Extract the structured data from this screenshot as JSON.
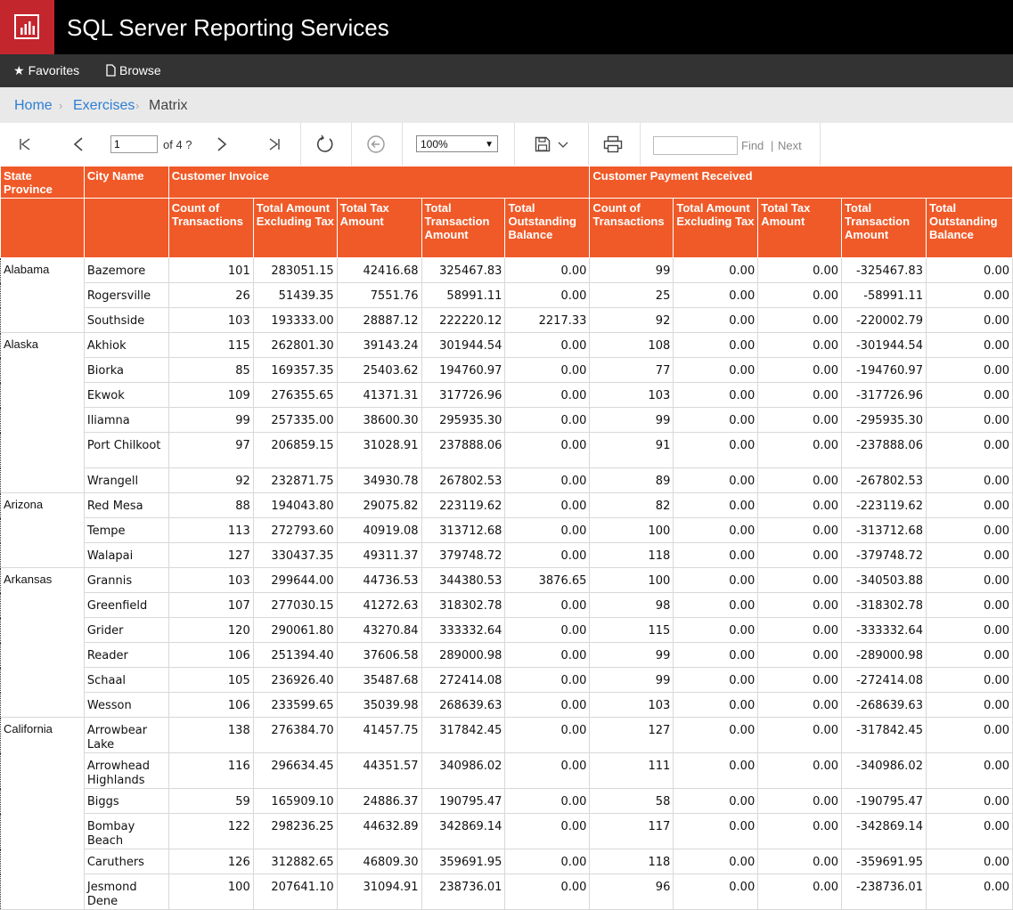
{
  "app": {
    "title": "SQL Server Reporting Services",
    "brand_color": "#c4262e"
  },
  "nav": {
    "favorites": "Favorites",
    "browse": "Browse"
  },
  "breadcrumb": {
    "home": "Home",
    "exercises": "Exercises",
    "current": "Matrix"
  },
  "toolbar": {
    "page_value": "1",
    "page_of": "of 4 ?",
    "zoom": "100%",
    "find_label": "Find",
    "pipe": "|",
    "next_label": "Next",
    "icons": [
      "first-page-icon",
      "previous-page-icon",
      "next-page-icon",
      "last-page-icon",
      "refresh-icon",
      "back-icon",
      "save-icon",
      "print-icon"
    ]
  },
  "report": {
    "header_color": "#f05a28",
    "headers": {
      "state": "State Province",
      "city": "City Name",
      "group_invoice": "Customer Invoice",
      "group_payment": "Customer Payment Received",
      "count": "Count of Transactions",
      "excl_tax": "Total Amount Excluding Tax",
      "tax": "Total Tax Amount",
      "transaction": "Total Transaction Amount",
      "outstanding": "Total Outstanding Balance"
    },
    "groups": [
      {
        "state": "Alabama",
        "rows": [
          [
            "Bazemore",
            "101",
            "283051.15",
            "42416.68",
            "325467.83",
            "0.00",
            "99",
            "0.00",
            "0.00",
            "-325467.83",
            "0.00"
          ],
          [
            "Rogersville",
            "26",
            "51439.35",
            "7551.76",
            "58991.11",
            "0.00",
            "25",
            "0.00",
            "0.00",
            "-58991.11",
            "0.00"
          ],
          [
            "Southside",
            "103",
            "193333.00",
            "28887.12",
            "222220.12",
            "2217.33",
            "92",
            "0.00",
            "0.00",
            "-220002.79",
            "0.00"
          ]
        ]
      },
      {
        "state": "Alaska",
        "rows": [
          [
            "Akhiok",
            "115",
            "262801.30",
            "39143.24",
            "301944.54",
            "0.00",
            "108",
            "0.00",
            "0.00",
            "-301944.54",
            "0.00"
          ],
          [
            "Biorka",
            "85",
            "169357.35",
            "25403.62",
            "194760.97",
            "0.00",
            "77",
            "0.00",
            "0.00",
            "-194760.97",
            "0.00"
          ],
          [
            "Ekwok",
            "109",
            "276355.65",
            "41371.31",
            "317726.96",
            "0.00",
            "103",
            "0.00",
            "0.00",
            "-317726.96",
            "0.00"
          ],
          [
            "Iliamna",
            "99",
            "257335.00",
            "38600.30",
            "295935.30",
            "0.00",
            "99",
            "0.00",
            "0.00",
            "-295935.30",
            "0.00"
          ],
          [
            "Port Chilkoot",
            "97",
            "206859.15",
            "31028.91",
            "237888.06",
            "0.00",
            "91",
            "0.00",
            "0.00",
            "-237888.06",
            "0.00"
          ],
          [
            "Wrangell",
            "92",
            "232871.75",
            "34930.78",
            "267802.53",
            "0.00",
            "89",
            "0.00",
            "0.00",
            "-267802.53",
            "0.00"
          ]
        ]
      },
      {
        "state": "Arizona",
        "rows": [
          [
            "Red Mesa",
            "88",
            "194043.80",
            "29075.82",
            "223119.62",
            "0.00",
            "82",
            "0.00",
            "0.00",
            "-223119.62",
            "0.00"
          ],
          [
            "Tempe",
            "113",
            "272793.60",
            "40919.08",
            "313712.68",
            "0.00",
            "100",
            "0.00",
            "0.00",
            "-313712.68",
            "0.00"
          ],
          [
            "Walapai",
            "127",
            "330437.35",
            "49311.37",
            "379748.72",
            "0.00",
            "118",
            "0.00",
            "0.00",
            "-379748.72",
            "0.00"
          ]
        ]
      },
      {
        "state": "Arkansas",
        "rows": [
          [
            "Grannis",
            "103",
            "299644.00",
            "44736.53",
            "344380.53",
            "3876.65",
            "100",
            "0.00",
            "0.00",
            "-340503.88",
            "0.00"
          ],
          [
            "Greenfield",
            "107",
            "277030.15",
            "41272.63",
            "318302.78",
            "0.00",
            "98",
            "0.00",
            "0.00",
            "-318302.78",
            "0.00"
          ],
          [
            "Grider",
            "120",
            "290061.80",
            "43270.84",
            "333332.64",
            "0.00",
            "115",
            "0.00",
            "0.00",
            "-333332.64",
            "0.00"
          ],
          [
            "Reader",
            "106",
            "251394.40",
            "37606.58",
            "289000.98",
            "0.00",
            "99",
            "0.00",
            "0.00",
            "-289000.98",
            "0.00"
          ],
          [
            "Schaal",
            "105",
            "236926.40",
            "35487.68",
            "272414.08",
            "0.00",
            "99",
            "0.00",
            "0.00",
            "-272414.08",
            "0.00"
          ],
          [
            "Wesson",
            "106",
            "233599.65",
            "35039.98",
            "268639.63",
            "0.00",
            "103",
            "0.00",
            "0.00",
            "-268639.63",
            "0.00"
          ]
        ]
      },
      {
        "state": "California",
        "rows": [
          [
            "Arrowbear Lake",
            "138",
            "276384.70",
            "41457.75",
            "317842.45",
            "0.00",
            "127",
            "0.00",
            "0.00",
            "-317842.45",
            "0.00"
          ],
          [
            "Arrowhead Highlands",
            "116",
            "296634.45",
            "44351.57",
            "340986.02",
            "0.00",
            "111",
            "0.00",
            "0.00",
            "-340986.02",
            "0.00"
          ],
          [
            "Biggs",
            "59",
            "165909.10",
            "24886.37",
            "190795.47",
            "0.00",
            "58",
            "0.00",
            "0.00",
            "-190795.47",
            "0.00"
          ],
          [
            "Bombay Beach",
            "122",
            "298236.25",
            "44632.89",
            "342869.14",
            "0.00",
            "117",
            "0.00",
            "0.00",
            "-342869.14",
            "0.00"
          ],
          [
            "Caruthers",
            "126",
            "312882.65",
            "46809.30",
            "359691.95",
            "0.00",
            "118",
            "0.00",
            "0.00",
            "-359691.95",
            "0.00"
          ],
          [
            "Jesmond Dene",
            "100",
            "207641.10",
            "31094.91",
            "238736.01",
            "0.00",
            "96",
            "0.00",
            "0.00",
            "-238736.01",
            "0.00"
          ]
        ]
      }
    ]
  }
}
